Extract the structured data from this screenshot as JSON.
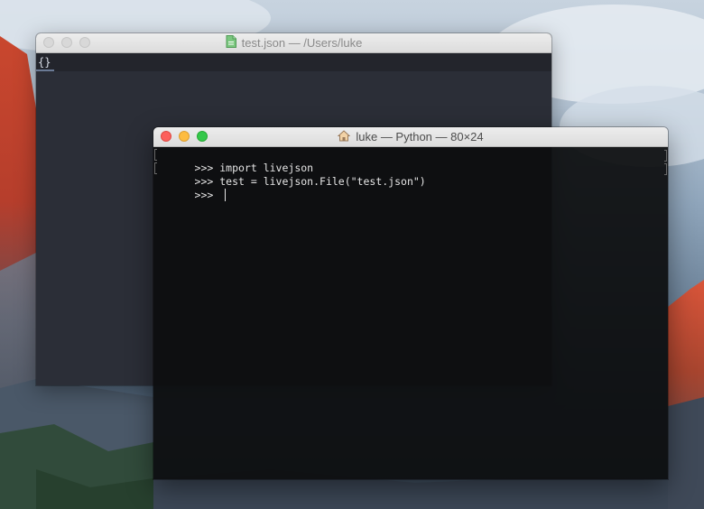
{
  "editor_window": {
    "title": "test.json — /Users/luke",
    "file_icon": "json-file-icon",
    "tab_label": "{}"
  },
  "terminal_window": {
    "title": "luke — Python — 80×24",
    "title_icon": "home-folder-icon",
    "lines": [
      ">>> import livejson",
      ">>> test = livejson.File(\"test.json\")",
      ">>> "
    ]
  },
  "colors": {
    "close": "#fc605c",
    "minimize": "#fdbc40",
    "zoom": "#34c84a",
    "terminal_bg": "#0c0d0e",
    "editor_bg": "#2b2e37"
  }
}
